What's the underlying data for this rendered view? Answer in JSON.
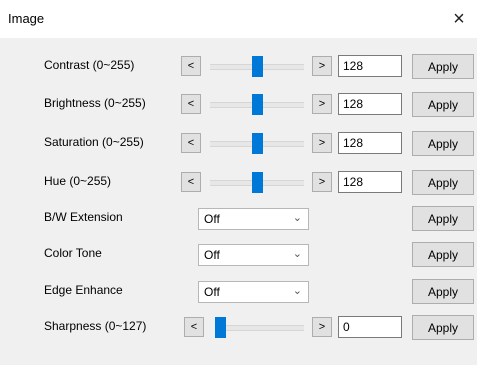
{
  "window": {
    "title": "Image",
    "close_glyph": "×"
  },
  "sliders": [
    {
      "label": "Contrast (0~255)",
      "value": "128",
      "level": 128,
      "max": 255,
      "prev": "<",
      "next": ">",
      "apply": "Apply"
    },
    {
      "label": "Brightness (0~255)",
      "value": "128",
      "level": 128,
      "max": 255,
      "prev": "<",
      "next": ">",
      "apply": "Apply"
    },
    {
      "label": "Saturation (0~255)",
      "value": "128",
      "level": 128,
      "max": 255,
      "prev": "<",
      "next": ">",
      "apply": "Apply"
    },
    {
      "label": "Hue (0~255)",
      "value": "128",
      "level": 128,
      "max": 255,
      "prev": "<",
      "next": ">",
      "apply": "Apply"
    }
  ],
  "dropdowns": [
    {
      "label": "B/W Extension",
      "selected": "Off",
      "apply": "Apply"
    },
    {
      "label": "Color Tone",
      "selected": "Off",
      "apply": "Apply"
    },
    {
      "label": "Edge Enhance",
      "selected": "Off",
      "apply": "Apply"
    }
  ],
  "sharpness": {
    "label": "Sharpness (0~127)",
    "value": "0",
    "level": 0,
    "max": 127,
    "prev": "<",
    "next": ">",
    "apply": "Apply"
  },
  "colors": {
    "accent": "#0078d7",
    "button_face": "#e1e1e1"
  },
  "icons": {
    "close": "close-icon",
    "dropdown": "chevron-down-icon"
  }
}
